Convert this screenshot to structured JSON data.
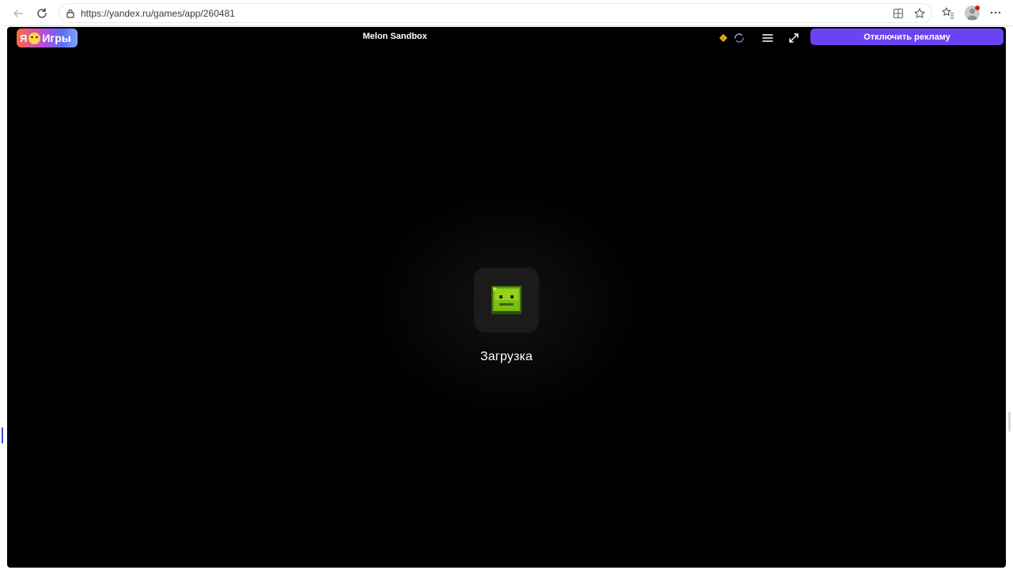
{
  "browser": {
    "url": "https://yandex.ru/games/app/260481"
  },
  "header": {
    "logo_letter": "Я",
    "logo_text": "Игры",
    "game_title": "Melon Sandbox",
    "ad_button_label": "Отключить рекламу"
  },
  "loading": {
    "label": "Загрузка"
  },
  "colors": {
    "accent": "#6b43f5",
    "background": "#000000",
    "melon": "#8fcd12"
  },
  "icons": {
    "back": "arrow-left-icon",
    "reload": "reload-icon",
    "lock": "lock-icon",
    "apps": "apps-icon",
    "favorite": "star-icon",
    "favorites_bar": "favorites-icon",
    "menu_more": "more-icon",
    "coin": "diamond-icon",
    "spinner": "spinner-icon",
    "hamburger": "menu-icon",
    "fullscreen": "fullscreen-icon",
    "game": "melon-icon"
  }
}
